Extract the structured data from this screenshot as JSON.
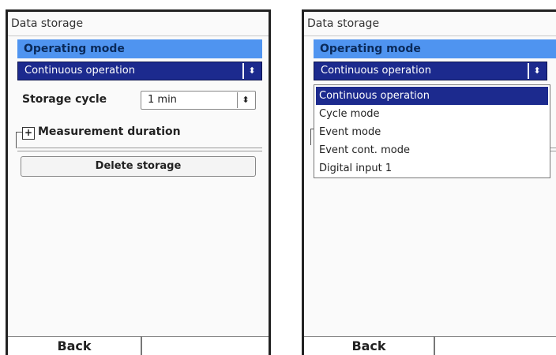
{
  "left_screen": {
    "title": "Data storage",
    "operating_mode_label": "Operating mode",
    "operating_mode_value": "Continuous operation",
    "storage_cycle_label": "Storage cycle",
    "storage_cycle_value": "1 min",
    "measurement_duration_label": "Measurement duration",
    "delete_button": "Delete storage",
    "back_button": "Back"
  },
  "right_screen": {
    "title": "Data storage",
    "operating_mode_label": "Operating mode",
    "operating_mode_value": "Continuous operation",
    "options": [
      "Continuous operation",
      "Cycle mode",
      "Event mode",
      "Event cont. mode",
      "Digital input 1"
    ],
    "back_button": "Back"
  },
  "icons": {
    "select_arrow": "up-down-arrow-icon",
    "expand": "plus-icon"
  }
}
